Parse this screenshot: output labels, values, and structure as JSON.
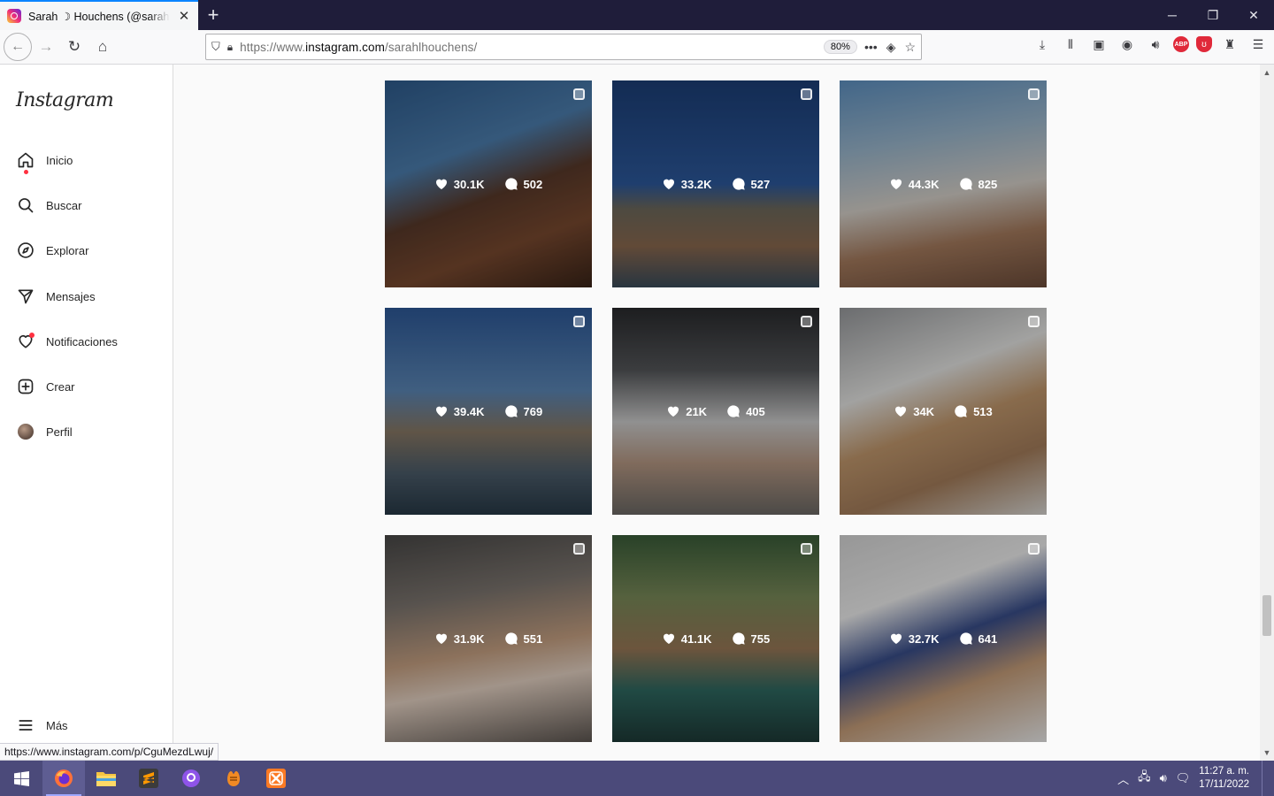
{
  "browser": {
    "tab_title": "Sarah ☽ Houchens (@sarahlhouchens)",
    "url_prefix": "https://www.",
    "url_domain": "instagram.com",
    "url_suffix": "/sarahlhouchens/",
    "zoom": "80%",
    "status_url": "https://www.instagram.com/p/CguMezdLwuj/"
  },
  "sidebar": {
    "logo": "Instagram",
    "items": [
      {
        "label": "Inicio",
        "icon": "home-icon"
      },
      {
        "label": "Buscar",
        "icon": "search-icon"
      },
      {
        "label": "Explorar",
        "icon": "compass-icon"
      },
      {
        "label": "Mensajes",
        "icon": "send-icon"
      },
      {
        "label": "Notificaciones",
        "icon": "heart-icon"
      },
      {
        "label": "Crear",
        "icon": "plus-square-icon"
      },
      {
        "label": "Perfil",
        "icon": "avatar"
      }
    ],
    "more": "Más"
  },
  "posts": [
    {
      "likes": "30.1K",
      "comments": "502"
    },
    {
      "likes": "33.2K",
      "comments": "527"
    },
    {
      "likes": "44.3K",
      "comments": "825"
    },
    {
      "likes": "39.4K",
      "comments": "769"
    },
    {
      "likes": "21K",
      "comments": "405"
    },
    {
      "likes": "34K",
      "comments": "513"
    },
    {
      "likes": "31.9K",
      "comments": "551"
    },
    {
      "likes": "41.1K",
      "comments": "755"
    },
    {
      "likes": "32.7K",
      "comments": "641"
    }
  ],
  "taskbar": {
    "time": "11:27 a. m.",
    "date": "17/11/2022"
  },
  "colors": {
    "tab_bar": "#1f1d3a",
    "taskbar": "#4b4a7a",
    "notification_dot": "#ff3040"
  }
}
